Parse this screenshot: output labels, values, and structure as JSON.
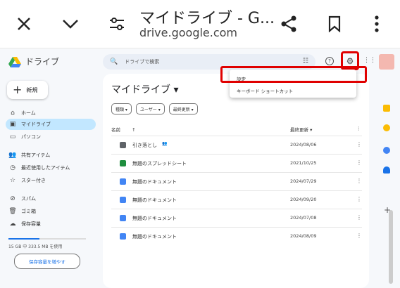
{
  "browser": {
    "title": "マイドライブ - G...",
    "url": "drive.google.com",
    "icons": [
      "close-icon",
      "chevron-down-icon",
      "tune-icon",
      "share-icon",
      "bookmark-icon",
      "more-vert-icon"
    ]
  },
  "drive": {
    "app_name": "ドライブ",
    "search_placeholder": "ドライブで検索",
    "new_label": "新規",
    "nav": [
      {
        "label": "ホーム",
        "icon": "home-icon"
      },
      {
        "label": "マイドライブ",
        "icon": "my-drive-icon"
      },
      {
        "label": "パソコン",
        "icon": "computer-icon"
      },
      {
        "label": "共有アイテム",
        "icon": "people-icon"
      },
      {
        "label": "最近使用したアイテム",
        "icon": "clock-icon"
      },
      {
        "label": "スター付き",
        "icon": "star-icon"
      },
      {
        "label": "スパム",
        "icon": "spam-icon"
      },
      {
        "label": "ゴミ箱",
        "icon": "trash-icon"
      },
      {
        "label": "保存容量",
        "icon": "cloud-icon"
      }
    ],
    "storage_text": "15 GB 中 333.5 MB を使用",
    "storage_fraction": 0.4,
    "storage_button": "保存容量を増やす",
    "main_title": "マイドライブ ▾",
    "chips": [
      "種類 ▾",
      "ユーザー ▾",
      "最終更新 ▾"
    ],
    "headers": {
      "name": "名前",
      "sort": "↑",
      "modified": "最終更新 ▾"
    },
    "files": [
      {
        "name": "引き落とし",
        "shared": "👥",
        "date": "2024/08/06",
        "type": "folder",
        "color": "#5f6368"
      },
      {
        "name": "無題のスプレッドシート",
        "date": "2021/10/25",
        "type": "sheet",
        "color": "#1e8e3e"
      },
      {
        "name": "無題のドキュメント",
        "date": "2024/07/29",
        "type": "doc",
        "color": "#4285f4"
      },
      {
        "name": "無題のドキュメント",
        "date": "2024/09/20",
        "type": "doc",
        "color": "#4285f4"
      },
      {
        "name": "無題のドキュメント",
        "date": "2024/07/08",
        "type": "doc",
        "color": "#4285f4"
      },
      {
        "name": "無題のドキュメント",
        "date": "2024/08/09",
        "type": "doc",
        "color": "#4285f4"
      }
    ],
    "menu": {
      "settings": "設定",
      "shortcuts": "キーボード ショートカット"
    },
    "highlight_color": "#e00000"
  }
}
